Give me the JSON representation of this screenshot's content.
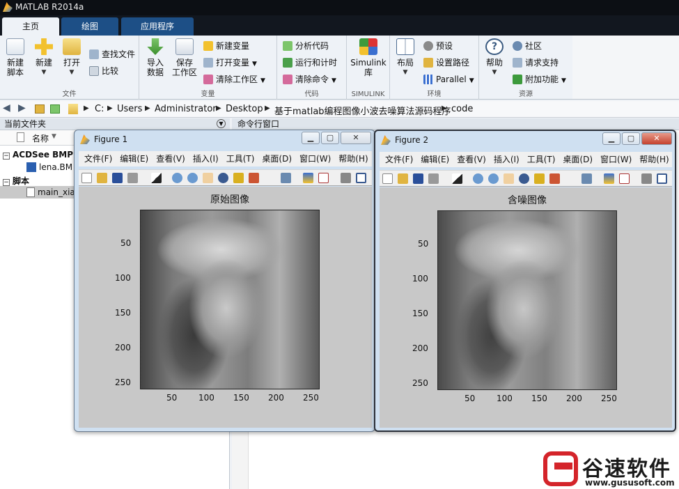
{
  "app": {
    "title": "MATLAB R2014a"
  },
  "tabs": [
    {
      "label": "主页",
      "active": true
    },
    {
      "label": "绘图",
      "active": false
    },
    {
      "label": "应用程序",
      "active": false
    }
  ],
  "ribbon": {
    "file": {
      "label": "文件",
      "new_script": "新建\n脚本",
      "new": "新建",
      "open": "打开",
      "find_files": "查找文件",
      "compare": "比较"
    },
    "variable": {
      "label": "变量",
      "import": "导入\n数据",
      "save_ws": "保存\n工作区",
      "new_var": "新建变量",
      "open_var": "打开变量",
      "clear_ws": "清除工作区"
    },
    "code": {
      "label": "代码",
      "analyze": "分析代码",
      "run_time": "运行和计时",
      "clear_cmd": "清除命令"
    },
    "simulink": {
      "label": "SIMULINK",
      "lib": "Simulink\n库"
    },
    "env": {
      "label": "环境",
      "layout": "布局",
      "prefs": "预设",
      "set_path": "设置路径",
      "parallel": "Parallel"
    },
    "resources": {
      "label": "资源",
      "help": "帮助",
      "community": "社区",
      "support": "请求支持",
      "addons": "附加功能"
    }
  },
  "address": {
    "crumbs": [
      "C:",
      "Users",
      "Administrator",
      "Desktop",
      "基于matlab编程图像小波去噪算法源码程序",
      "code"
    ]
  },
  "current_folder": {
    "header": "当前文件夹",
    "col_name": "名称",
    "group1": "ACDSee BMP I",
    "file1": "lena.BM",
    "group2": "脚本",
    "file2": "main_xia"
  },
  "command_window": {
    "header": "命令行窗口"
  },
  "figure1": {
    "title": "Figure 1",
    "menu": [
      "文件(F)",
      "编辑(E)",
      "查看(V)",
      "插入(I)",
      "工具(T)",
      "桌面(D)",
      "窗口(W)",
      "帮助(H)"
    ],
    "axes_title": "原始图像",
    "yticks": [
      "50",
      "100",
      "150",
      "200",
      "250"
    ],
    "xticks": [
      "50",
      "100",
      "150",
      "200",
      "250"
    ]
  },
  "figure2": {
    "title": "Figure 2",
    "menu": [
      "文件(F)",
      "编辑(E)",
      "查看(V)",
      "插入(I)",
      "工具(T)",
      "桌面(D)",
      "窗口(W)",
      "帮助(H)"
    ],
    "axes_title": "含噪图像",
    "yticks": [
      "50",
      "100",
      "150",
      "200",
      "250"
    ],
    "xticks": [
      "50",
      "100",
      "150",
      "200",
      "250"
    ]
  },
  "watermark": {
    "name": "谷速软件",
    "url": "www.gususoft.com"
  },
  "colors": {
    "titlebar": "#0c0f14",
    "tab": "#1d4f86",
    "ribbon": "#eef2f7",
    "brand_red": "#d4242a"
  }
}
